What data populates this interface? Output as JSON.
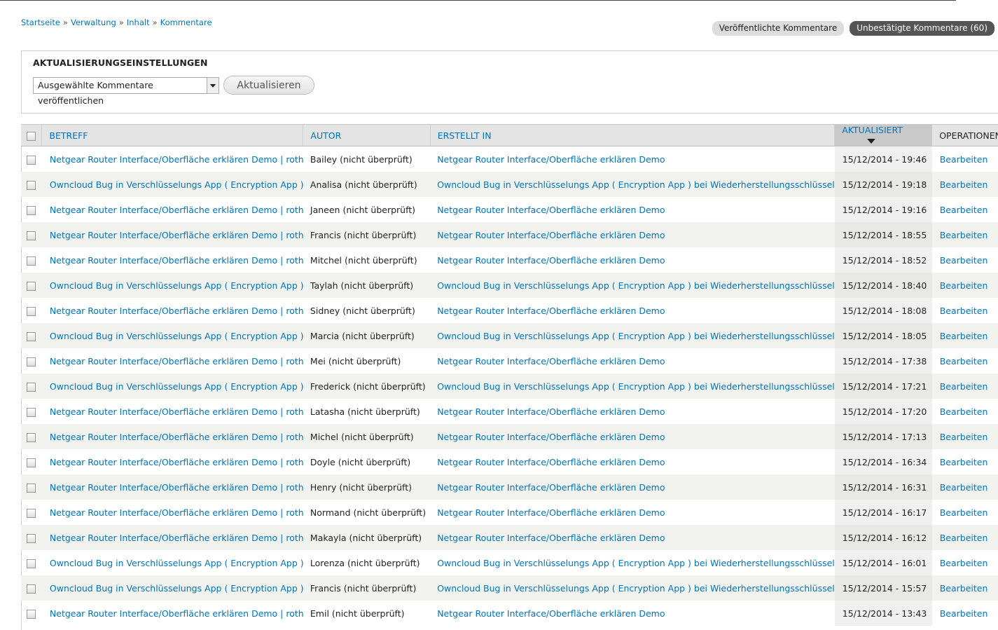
{
  "breadcrumb": [
    "Startseite",
    "Verwaltung",
    "Inhalt",
    "Kommentare"
  ],
  "breadcrumb_sep": "»",
  "tabs": [
    "Veröffentlichte Kommentare",
    "Unbestätigte Kommentare (60)"
  ],
  "update": {
    "legend": "AKTUALISIERUNGSEINSTELLUNGEN",
    "select_value": "Ausgewählte Kommentare veröffentlichen",
    "button": "Aktualisieren"
  },
  "columns": [
    "BETREFF",
    "AUTOR",
    "ERSTELLT IN",
    "AKTUALISIERT",
    "OPERATIONEN"
  ],
  "rows": [
    {
      "subject": "Netgear Router Interface/Oberfläche erklären Demo | rothlive.",
      "author": "Bailey (nicht überprüft)",
      "node": "Netgear Router Interface/Oberfläche erklären Demo",
      "updated": "15/12/2014 - 19:46",
      "op": "Bearbeiten"
    },
    {
      "subject": "Owncloud Bug in Verschlüsselungs App ( Encryption App ) bei",
      "author": "Analisa (nicht überprüft)",
      "node": "Owncloud Bug in Verschlüsselungs App ( Encryption App ) bei Wiederherstellungsschlüssel",
      "updated": "15/12/2014 - 19:18",
      "op": "Bearbeiten"
    },
    {
      "subject": "Netgear Router Interface/Oberfläche erklären Demo | rothlive.",
      "author": "Janeen (nicht überprüft)",
      "node": "Netgear Router Interface/Oberfläche erklären Demo",
      "updated": "15/12/2014 - 19:16",
      "op": "Bearbeiten"
    },
    {
      "subject": "Netgear Router Interface/Oberfläche erklären Demo | rothlive.",
      "author": "Francis (nicht überprüft)",
      "node": "Netgear Router Interface/Oberfläche erklären Demo",
      "updated": "15/12/2014 - 18:55",
      "op": "Bearbeiten"
    },
    {
      "subject": "Netgear Router Interface/Oberfläche erklären Demo | rothlive.",
      "author": "Mitchel (nicht überprüft)",
      "node": "Netgear Router Interface/Oberfläche erklären Demo",
      "updated": "15/12/2014 - 18:52",
      "op": "Bearbeiten"
    },
    {
      "subject": "Owncloud Bug in Verschlüsselungs App ( Encryption App ) bei",
      "author": "Taylah (nicht überprüft)",
      "node": "Owncloud Bug in Verschlüsselungs App ( Encryption App ) bei Wiederherstellungsschlüssel",
      "updated": "15/12/2014 - 18:40",
      "op": "Bearbeiten"
    },
    {
      "subject": "Netgear Router Interface/Oberfläche erklären Demo | rothlive.",
      "author": "Sidney (nicht überprüft)",
      "node": "Netgear Router Interface/Oberfläche erklären Demo",
      "updated": "15/12/2014 - 18:08",
      "op": "Bearbeiten"
    },
    {
      "subject": "Owncloud Bug in Verschlüsselungs App ( Encryption App ) bei",
      "author": "Marcia (nicht überprüft)",
      "node": "Owncloud Bug in Verschlüsselungs App ( Encryption App ) bei Wiederherstellungsschlüssel",
      "updated": "15/12/2014 - 18:05",
      "op": "Bearbeiten"
    },
    {
      "subject": "Netgear Router Interface/Oberfläche erklären Demo | rothlive.",
      "author": "Mei (nicht überprüft)",
      "node": "Netgear Router Interface/Oberfläche erklären Demo",
      "updated": "15/12/2014 - 17:38",
      "op": "Bearbeiten"
    },
    {
      "subject": "Owncloud Bug in Verschlüsselungs App ( Encryption App ) bei",
      "author": "Frederick (nicht überprüft)",
      "node": "Owncloud Bug in Verschlüsselungs App ( Encryption App ) bei Wiederherstellungsschlüssel",
      "updated": "15/12/2014 - 17:21",
      "op": "Bearbeiten"
    },
    {
      "subject": "Netgear Router Interface/Oberfläche erklären Demo | rothlive.",
      "author": "Latasha (nicht überprüft)",
      "node": "Netgear Router Interface/Oberfläche erklären Demo",
      "updated": "15/12/2014 - 17:20",
      "op": "Bearbeiten"
    },
    {
      "subject": "Netgear Router Interface/Oberfläche erklären Demo | rothlive.",
      "author": "Michel (nicht überprüft)",
      "node": "Netgear Router Interface/Oberfläche erklären Demo",
      "updated": "15/12/2014 - 17:13",
      "op": "Bearbeiten"
    },
    {
      "subject": "Netgear Router Interface/Oberfläche erklären Demo | rothlive.",
      "author": "Doyle (nicht überprüft)",
      "node": "Netgear Router Interface/Oberfläche erklären Demo",
      "updated": "15/12/2014 - 16:34",
      "op": "Bearbeiten"
    },
    {
      "subject": "Netgear Router Interface/Oberfläche erklären Demo | rothlive.",
      "author": "Henry (nicht überprüft)",
      "node": "Netgear Router Interface/Oberfläche erklären Demo",
      "updated": "15/12/2014 - 16:31",
      "op": "Bearbeiten"
    },
    {
      "subject": "Netgear Router Interface/Oberfläche erklären Demo | rothlive.",
      "author": "Normand (nicht überprüft)",
      "node": "Netgear Router Interface/Oberfläche erklären Demo",
      "updated": "15/12/2014 - 16:17",
      "op": "Bearbeiten"
    },
    {
      "subject": "Netgear Router Interface/Oberfläche erklären Demo | rothlive.",
      "author": "Makayla (nicht überprüft)",
      "node": "Netgear Router Interface/Oberfläche erklären Demo",
      "updated": "15/12/2014 - 16:12",
      "op": "Bearbeiten"
    },
    {
      "subject": "Owncloud Bug in Verschlüsselungs App ( Encryption App ) bei",
      "author": "Lorenza (nicht überprüft)",
      "node": "Owncloud Bug in Verschlüsselungs App ( Encryption App ) bei Wiederherstellungsschlüssel",
      "updated": "15/12/2014 - 16:01",
      "op": "Bearbeiten"
    },
    {
      "subject": "Owncloud Bug in Verschlüsselungs App ( Encryption App ) bei",
      "author": "Francis (nicht überprüft)",
      "node": "Owncloud Bug in Verschlüsselungs App ( Encryption App ) bei Wiederherstellungsschlüssel",
      "updated": "15/12/2014 - 15:57",
      "op": "Bearbeiten"
    },
    {
      "subject": "Netgear Router Interface/Oberfläche erklären Demo | rothlive.",
      "author": "Emil (nicht überprüft)",
      "node": "Netgear Router Interface/Oberfläche erklären Demo",
      "updated": "15/12/2014 - 13:43",
      "op": "Bearbeiten"
    }
  ],
  "colors": {
    "link": "#0074bd",
    "active_tab": "#555555",
    "header_bg": "#e4e4e4",
    "sorted_header_bg": "#c9c9c9",
    "zebra": "#f2f2ef"
  },
  "icons": {
    "sort": "sort-desc-icon",
    "select": "dropdown-arrow-icon"
  }
}
